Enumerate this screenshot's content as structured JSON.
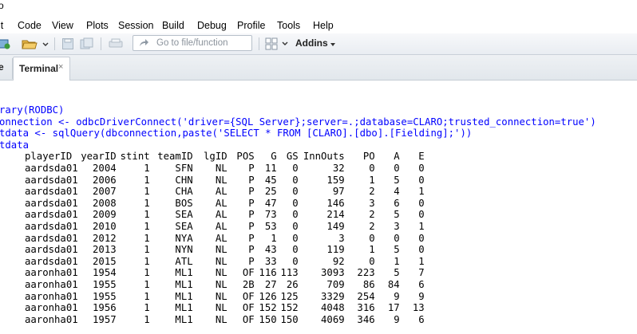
{
  "window": {
    "title_fragment": "o"
  },
  "menu": [
    "it",
    "Code",
    "View",
    "Plots",
    "Session",
    "Build",
    "Debug",
    "Profile",
    "Tools",
    "Help"
  ],
  "toolbar": {
    "goto_placeholder": "Go to file/function",
    "addins_label": "Addins"
  },
  "tabs": {
    "partial_label": "e",
    "terminal_label": "Terminal",
    "close_glyph": "×"
  },
  "console": {
    "commands": [
      "rary(RODBC)",
      "onnection <- odbcDriverConnect('driver={SQL Server};server=.;database=CLARO;trusted_connection=true')",
      "tdata <- sqlQuery(dbconnection,paste('SELECT * FROM [CLARO].[dbo].[Fielding];'))",
      "tdata"
    ],
    "table": {
      "columns": [
        "",
        "playerID",
        "yearID",
        "stint",
        "teamID",
        "lgID",
        "POS",
        "G",
        "GS",
        "InnOuts",
        "PO",
        "A",
        "E"
      ],
      "rows": [
        [
          "",
          "aardsda01",
          "2004",
          "1",
          "SFN",
          "NL",
          "P",
          "11",
          "0",
          "32",
          "0",
          "0",
          "0"
        ],
        [
          "",
          "aardsda01",
          "2006",
          "1",
          "CHN",
          "NL",
          "P",
          "45",
          "0",
          "159",
          "1",
          "5",
          "0"
        ],
        [
          "",
          "aardsda01",
          "2007",
          "1",
          "CHA",
          "AL",
          "P",
          "25",
          "0",
          "97",
          "2",
          "4",
          "1"
        ],
        [
          "",
          "aardsda01",
          "2008",
          "1",
          "BOS",
          "AL",
          "P",
          "47",
          "0",
          "146",
          "3",
          "6",
          "0"
        ],
        [
          "",
          "aardsda01",
          "2009",
          "1",
          "SEA",
          "AL",
          "P",
          "73",
          "0",
          "214",
          "2",
          "5",
          "0"
        ],
        [
          "",
          "aardsda01",
          "2010",
          "1",
          "SEA",
          "AL",
          "P",
          "53",
          "0",
          "149",
          "2",
          "3",
          "1"
        ],
        [
          "",
          "aardsda01",
          "2012",
          "1",
          "NYA",
          "AL",
          "P",
          "1",
          "0",
          "3",
          "0",
          "0",
          "0"
        ],
        [
          "",
          "aardsda01",
          "2013",
          "1",
          "NYN",
          "NL",
          "P",
          "43",
          "0",
          "119",
          "1",
          "5",
          "0"
        ],
        [
          "",
          "aardsda01",
          "2015",
          "1",
          "ATL",
          "NL",
          "P",
          "33",
          "0",
          "92",
          "0",
          "1",
          "1"
        ],
        [
          "",
          "aaronha01",
          "1954",
          "1",
          "ML1",
          "NL",
          "OF",
          "116",
          "113",
          "3093",
          "223",
          "5",
          "7"
        ],
        [
          "",
          "aaronha01",
          "1955",
          "1",
          "ML1",
          "NL",
          "2B",
          "27",
          "26",
          "709",
          "86",
          "84",
          "6"
        ],
        [
          "",
          "aaronha01",
          "1955",
          "1",
          "ML1",
          "NL",
          "OF",
          "126",
          "125",
          "3329",
          "254",
          "9",
          "9"
        ],
        [
          "",
          "aaronha01",
          "1956",
          "1",
          "ML1",
          "NL",
          "OF",
          "152",
          "152",
          "4048",
          "316",
          "17",
          "13"
        ],
        [
          "",
          "aaronha01",
          "1957",
          "1",
          "ML1",
          "NL",
          "OF",
          "150",
          "150",
          "4069",
          "346",
          "9",
          "6"
        ]
      ]
    }
  },
  "colors": {
    "command_text": "#0000ff",
    "output_text": "#000000",
    "accent": "#2a74c4"
  }
}
